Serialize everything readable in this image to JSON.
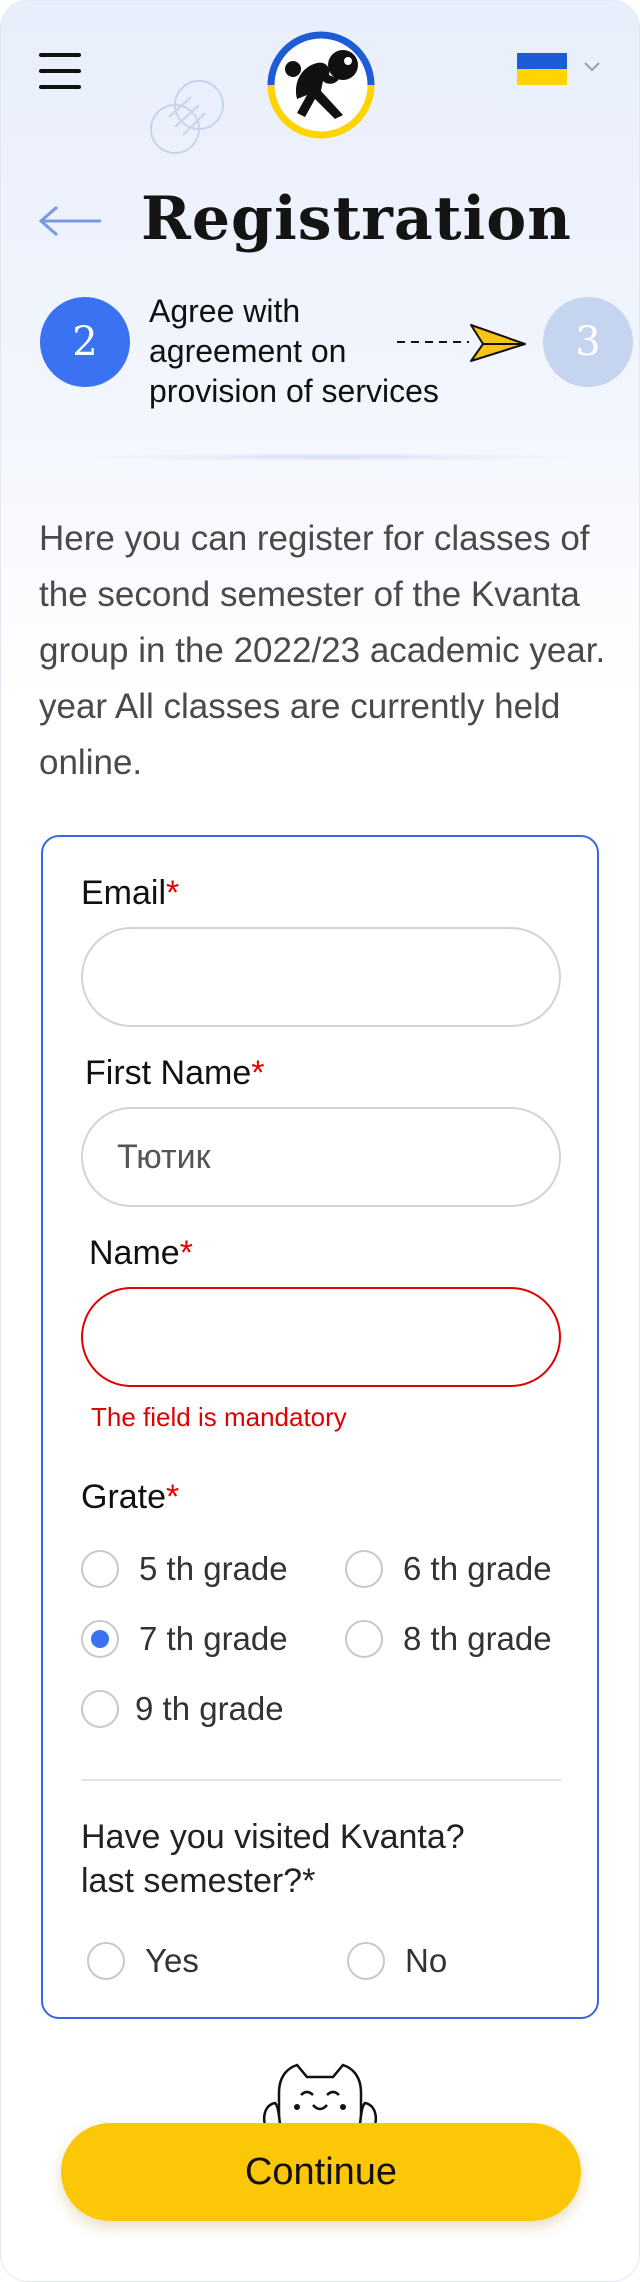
{
  "header": {
    "menu_icon": "hamburger-menu-icon",
    "logo_icon": "kvanta-logo",
    "language_flag": "ukraine-flag-icon",
    "colors": {
      "flag_blue": "#1e5bd6",
      "flag_yellow": "#ffd400"
    }
  },
  "title": "Registration",
  "stepper": {
    "current_step": "2",
    "current_label": [
      "Agree with",
      "agreement on",
      "provision of services"
    ],
    "next_step": "3",
    "connector_icon": "paper-plane-icon",
    "colors": {
      "current": "#3b72f2",
      "next": "#c5d4ef"
    }
  },
  "intro": "Here you can register for classes of the second semester of the Kvanta group in the 2022/23 academic year. year All classes are currently held online.",
  "form": {
    "email": {
      "label": "Email",
      "required_mark": "*",
      "value": "",
      "placeholder": ""
    },
    "first_name": {
      "label": "First Name",
      "required_mark": "*",
      "value": "",
      "placeholder": "Тютик"
    },
    "name": {
      "label": "Name",
      "required_mark": "*",
      "value": "",
      "placeholder": "",
      "error": "The field is mandatory"
    },
    "grade": {
      "label": "Grate",
      "required_mark": "*",
      "options": [
        "5 th grade",
        "6 th grade",
        "7 th grade",
        "8 th grade",
        "9 th grade"
      ],
      "selected": "7 th grade"
    },
    "visited": {
      "question": "Have you visited Kvanta? last semester?*",
      "options": [
        "Yes",
        "No"
      ],
      "selected": null
    }
  },
  "mascot_icon": "cat-mascot-icon",
  "continue_label": "Continue",
  "colors": {
    "accent": "#3b72f2",
    "button": "#fcc707",
    "error": "#e00000"
  }
}
